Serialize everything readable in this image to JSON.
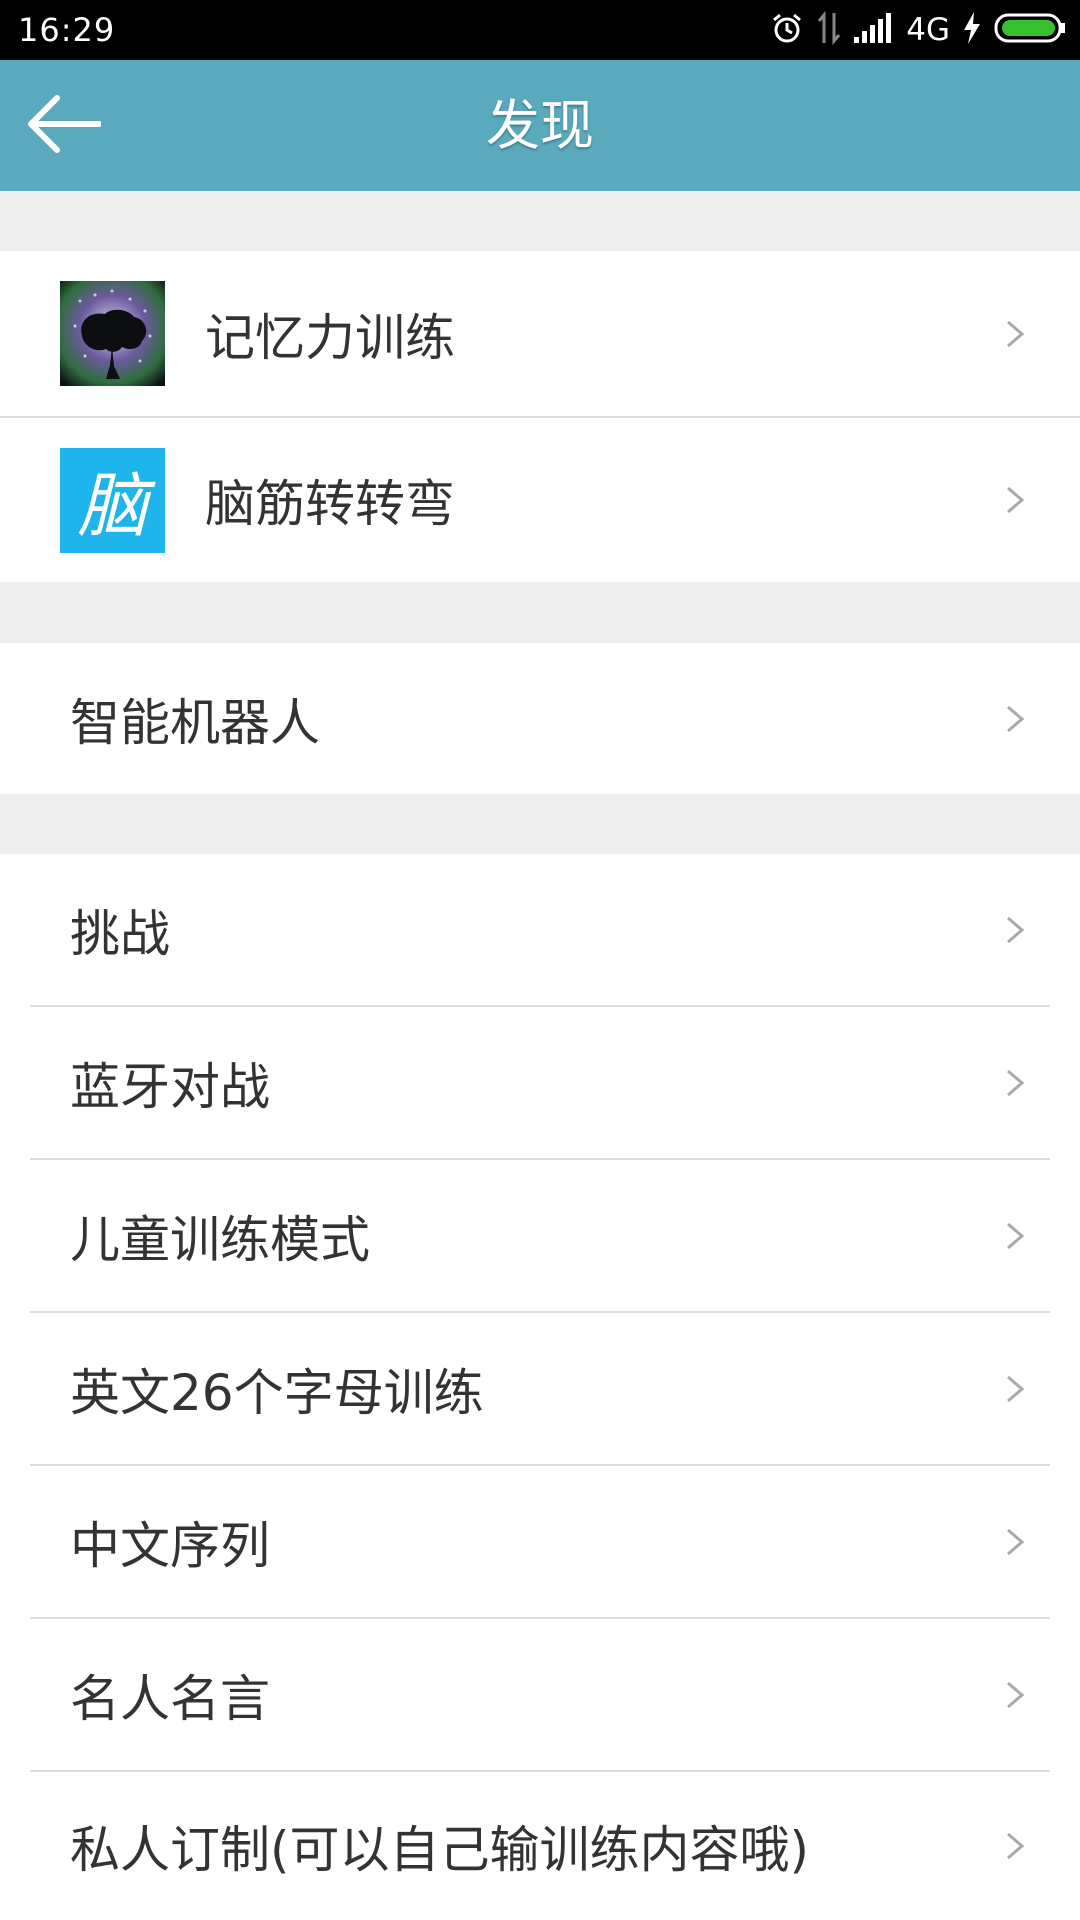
{
  "status_bar": {
    "time": "16:29",
    "network": "4G",
    "icons": [
      "alarm-icon",
      "data-arrows-icon",
      "signal-icon",
      "charging-icon",
      "battery-icon"
    ],
    "battery_color": "#36c22e"
  },
  "app_bar": {
    "title": "发现",
    "back_icon": "back-arrow-icon",
    "color": "#5aa9bd"
  },
  "sections": [
    {
      "items": [
        {
          "label": "记忆力训练",
          "icon": "brain-app-icon"
        },
        {
          "label": "脑筋转转弯",
          "icon": "nao-app-icon",
          "icon_glyph": "脑"
        }
      ]
    },
    {
      "items": [
        {
          "label": "智能机器人"
        }
      ]
    },
    {
      "items": [
        {
          "label": "挑战"
        },
        {
          "label": "蓝牙对战"
        },
        {
          "label": "儿童训练模式"
        },
        {
          "label": "英文26个字母训练"
        },
        {
          "label": "中文序列"
        },
        {
          "label": "名人名言"
        },
        {
          "label": "私人订制(可以自己输训练内容哦)"
        }
      ]
    }
  ]
}
